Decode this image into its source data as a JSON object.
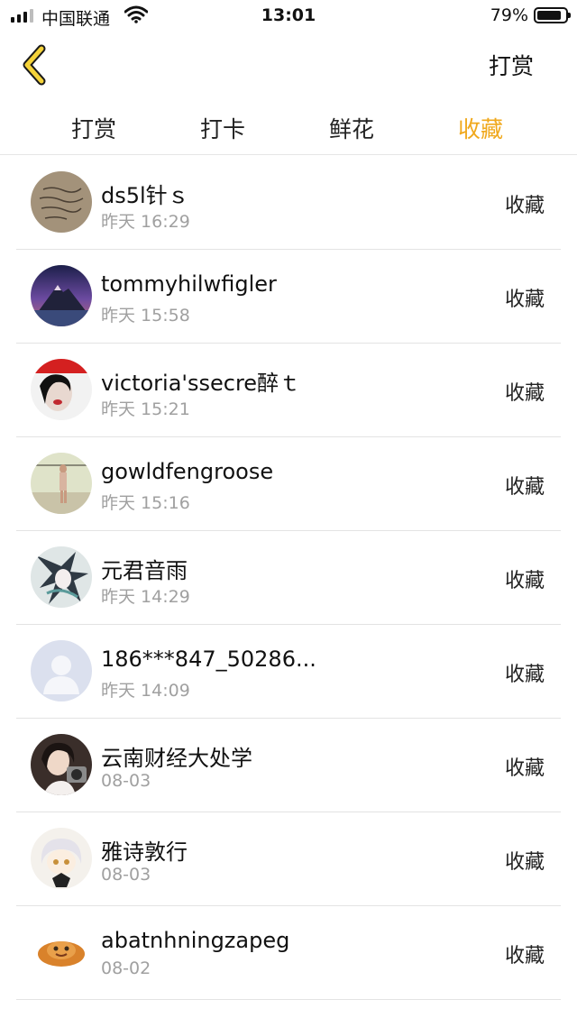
{
  "status_bar": {
    "carrier": "中国联通",
    "time": "13:01",
    "battery": "79%",
    "battery_level": 0.79
  },
  "nav": {
    "back_icon": "chevron-left-icon",
    "right_action": "打赏"
  },
  "tabs": [
    {
      "label": "打赏",
      "active": false
    },
    {
      "label": "打卡",
      "active": false
    },
    {
      "label": "鲜花",
      "active": false
    },
    {
      "label": "收藏",
      "active": true
    }
  ],
  "colors": {
    "accent": "#f0a81c",
    "back_icon": "#f5d33a",
    "divider": "#e3e3e3",
    "secondary_text": "#a0a0a0"
  },
  "users": [
    {
      "name": "ds5l针ｓ",
      "time": "昨天 16:29",
      "action": "收藏"
    },
    {
      "name": "tommyhilwfigler",
      "time": "昨天 15:58",
      "action": "收藏"
    },
    {
      "name": "victoria'ssecre醉ｔ",
      "time": "昨天 15:21",
      "action": "收藏"
    },
    {
      "name": "gowldfengroose",
      "time": "昨天 15:16",
      "action": "收藏"
    },
    {
      "name": "元君音雨",
      "time": "昨天 14:29",
      "action": "收藏"
    },
    {
      "name": "186***847_50286...",
      "time": "昨天 14:09",
      "action": "收藏"
    },
    {
      "name": "云南财经大处学",
      "time": "08-03",
      "action": "收藏"
    },
    {
      "name": "雅诗敦行",
      "time": "08-03",
      "action": "收藏"
    },
    {
      "name": "abatnhningzapeg",
      "time": "08-02",
      "action": "收藏"
    }
  ]
}
